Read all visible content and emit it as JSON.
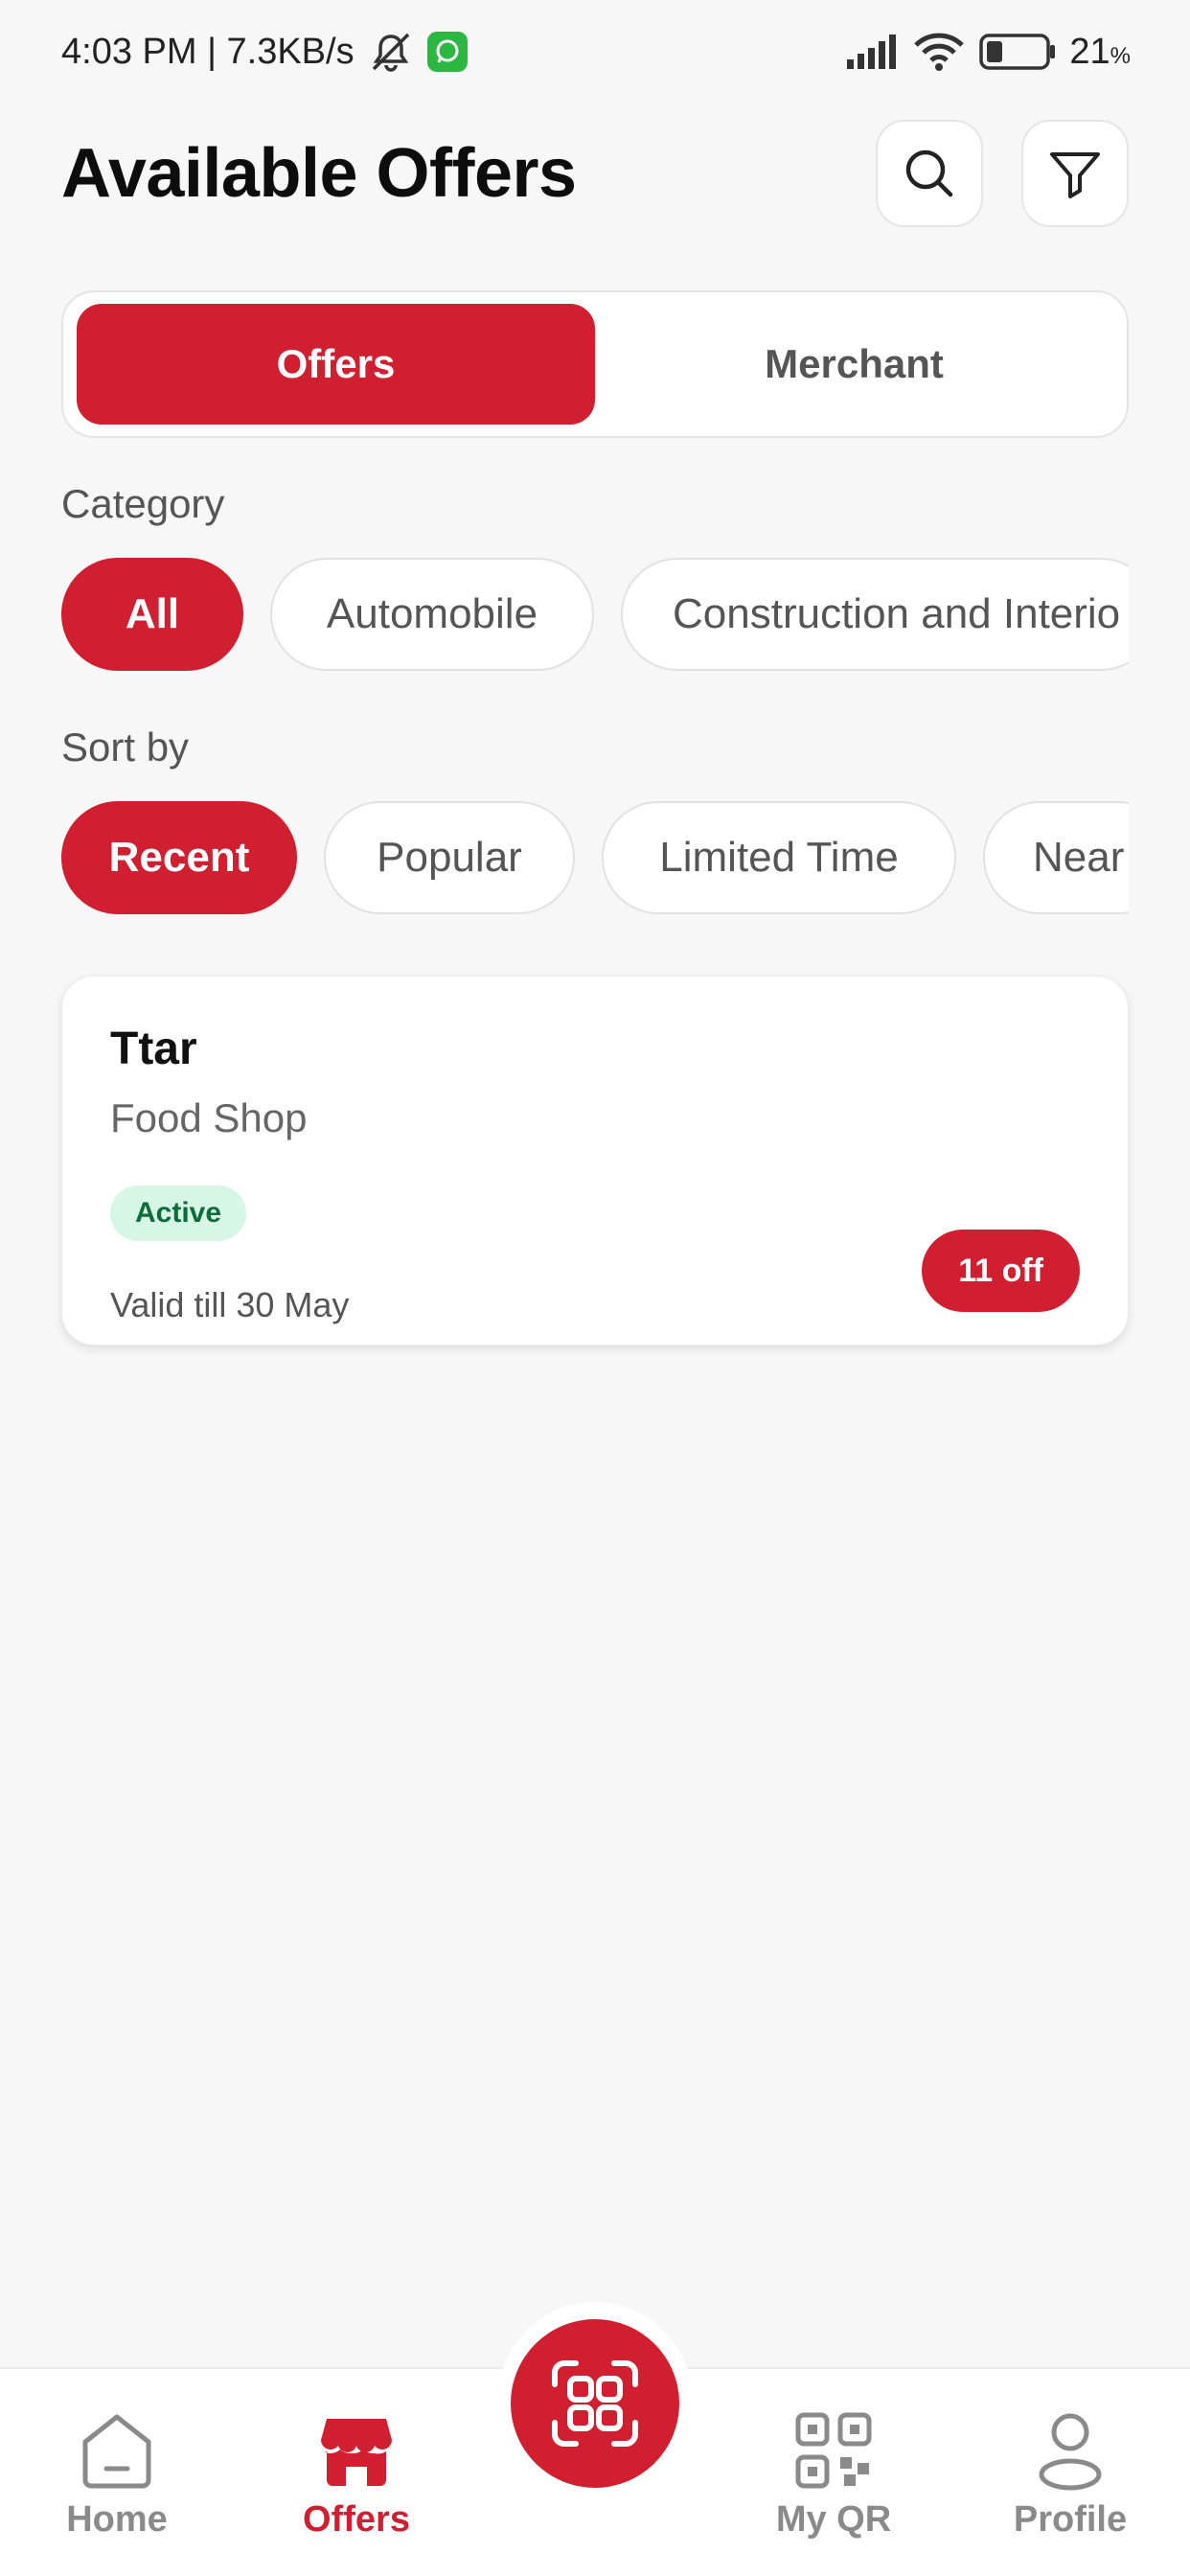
{
  "status_bar": {
    "time_speed": "4:03 PM | 7.3KB/s",
    "battery_percent": "21",
    "battery_unit": "%"
  },
  "header": {
    "title": "Available Offers"
  },
  "tabs": [
    {
      "label": "Offers",
      "active": true
    },
    {
      "label": "Merchant",
      "active": false
    }
  ],
  "category": {
    "label": "Category",
    "chips": [
      "All",
      "Automobile",
      "Construction and Interio"
    ]
  },
  "sort": {
    "label": "Sort by",
    "chips": [
      "Recent",
      "Popular",
      "Limited Time",
      "Near"
    ]
  },
  "offers": [
    {
      "name": "Ttar",
      "category": "Food Shop",
      "status": "Active",
      "valid": "Valid till 30 May",
      "discount": "11 off"
    }
  ],
  "bottom_nav": {
    "items": [
      {
        "label": "Home",
        "icon": "home-icon"
      },
      {
        "label": "Offers",
        "icon": "store-icon"
      },
      {
        "label": "My QR",
        "icon": "qr-icon"
      },
      {
        "label": "Profile",
        "icon": "profile-icon"
      }
    ],
    "fab_icon": "scan-icon"
  },
  "colors": {
    "primary": "#cf1f31",
    "active_badge_bg": "#d8f6e6",
    "active_badge_text": "#0e6b3a"
  }
}
